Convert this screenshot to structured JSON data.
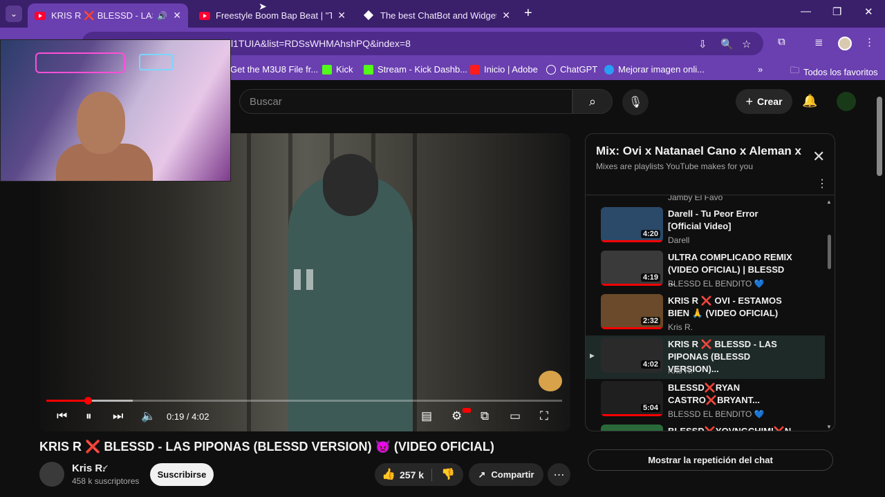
{
  "browser": {
    "tabs": [
      {
        "title": "KRIS R ❌ BLESSD - LAS PIPONAS",
        "active": true,
        "audio": true
      },
      {
        "title": "Freestyle Boom Bap Beat | \"TEN",
        "active": false
      },
      {
        "title": "The best ChatBot and Widgets",
        "active": false
      }
    ],
    "new_tab_label": "+",
    "url": "l1TUIA&list=RDSsWHMAhshPQ&index=8",
    "bookmarks": [
      {
        "label": "Get the M3U8 File fr...",
        "color": "#f1a33a"
      },
      {
        "label": "Kick",
        "color": "#53fc18"
      },
      {
        "label": "Stream - Kick Dashb...",
        "color": "#53fc18"
      },
      {
        "label": "Inicio | Adobe",
        "color": "#ff1c1c"
      },
      {
        "label": "ChatGPT",
        "color": "#ffffff"
      },
      {
        "label": "Mejorar imagen onli...",
        "color": "#2a9df4"
      }
    ],
    "bookmarks_overflow": "»",
    "all_favorites_label": "Todos los favoritos"
  },
  "youtube": {
    "search_placeholder": "Buscar",
    "create_label": "Crear",
    "player": {
      "time": "0:19 / 4:02",
      "progress_fraction": 0.08,
      "buffered_fraction": 0.167
    },
    "video": {
      "title": "KRIS R ❌ BLESSD - LAS PIPONAS (BLESSD VERSION) 👿 (VIDEO OFICIAL)",
      "channel": "Kris R.",
      "verified_mark": "✔",
      "subscribers": "458 k suscriptores",
      "subscribe_label": "Suscribirse",
      "likes": "257 k",
      "share_label": "Compartir"
    },
    "playlist": {
      "title": "Mix: Ovi x Natanael Cano x Aleman x Kris R",
      "subtitle": "Mixes are playlists YouTube makes for you",
      "partial_channel": "Jamby El Favo",
      "items": [
        {
          "title": "Darell - Tu Peor Error [Official Video]",
          "channel": "Darell",
          "duration": "4:20",
          "color": "#2b4a6a"
        },
        {
          "title": "ULTRA COMPLICADO REMIX (VIDEO OFICIAL) | BLESSD ...",
          "channel": "BLESSD EL BENDITO 💙",
          "duration": "4:19",
          "color": "#3a3a3a"
        },
        {
          "title": "KRIS R ❌ OVI - ESTAMOS BIEN 🙏 (VIDEO OFICIAL)",
          "channel": "Kris R.",
          "duration": "2:32",
          "color": "#6a4a2a"
        },
        {
          "title": "KRIS R ❌ BLESSD - LAS PIPONAS (BLESSD VERSION)...",
          "channel": "Kris R.",
          "duration": "4:02",
          "color": "#2a2a2a",
          "current": true
        },
        {
          "title": "BLESSD❌RYAN CASTRO❌BRYANT...",
          "channel": "BLESSD EL BENDITO 💙",
          "duration": "5:04",
          "color": "#1f1f1f"
        },
        {
          "title": "BLESSD❌YOVNGCHIMI❌N...",
          "channel": "",
          "duration": "",
          "color": "#2a6a3a"
        }
      ]
    },
    "chat_replay_label": "Mostrar la repetición del chat"
  }
}
